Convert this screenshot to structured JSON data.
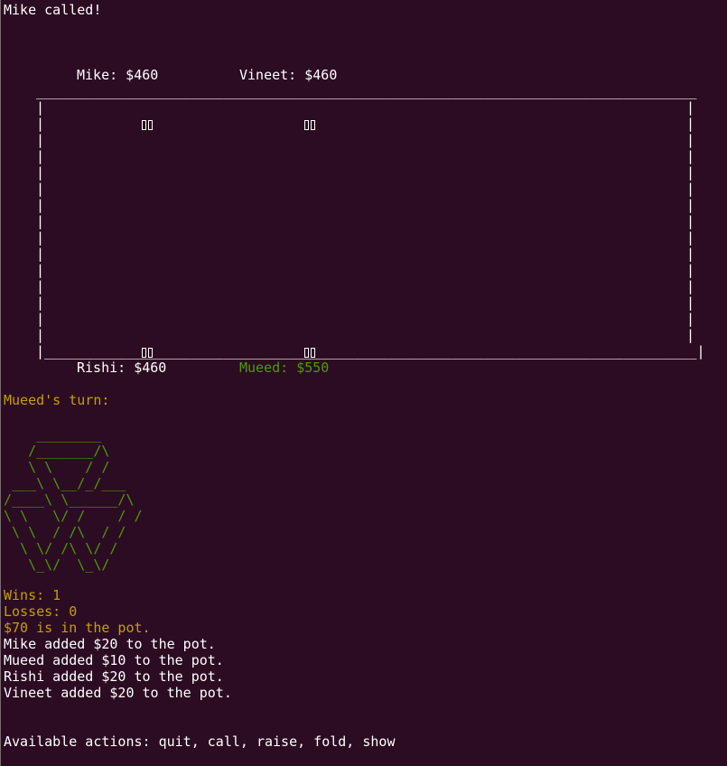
{
  "log": {
    "last_event": "Mike called!"
  },
  "players": {
    "mike": "Mike: $460",
    "vineet": "Vineet: $460",
    "rishi": "Rishi: $460",
    "mueed": "Mueed: $550"
  },
  "table": {
    "top_edge": "_________________________________________________________________________________",
    "bottom_edge": "|________________________________________________________________________________|",
    "side": "|"
  },
  "turn": {
    "label": "Mueed's turn:"
  },
  "logo_art": "    ________\n   /_______/\\\n   \\ \\    / /\n ___\\ \\__/_/___\n/____\\ \\______/\\\n\\ \\   \\/ /    / /\n \\ \\  / /\\  / /\n  \\ \\/ /\\ \\/ /\n   \\_\\/  \\_\\/",
  "stats": {
    "wins": "Wins: 1",
    "losses": "Losses: 0",
    "pot": "$70 is in the pot."
  },
  "history": [
    "Mike added $20 to the pot.",
    "Mueed added $10 to the pot.",
    "Rishi added $20 to the pot.",
    "Vineet added $20 to the pot."
  ],
  "prompt": {
    "actions": "Available actions: quit, call, raise, fold, show"
  },
  "colors": {
    "background": "#2c0c23",
    "text": "#ffffff",
    "highlight_yellow": "#c4a000",
    "highlight_green": "#4e9a06"
  }
}
